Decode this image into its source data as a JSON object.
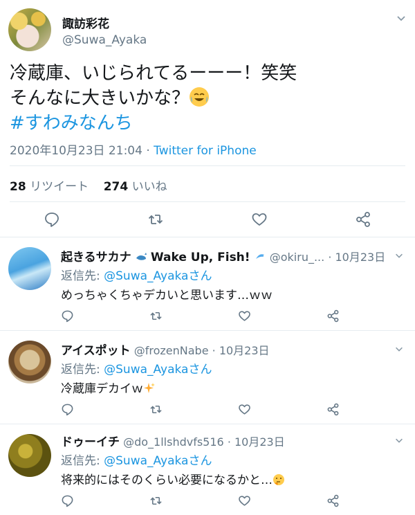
{
  "tweet": {
    "name": "諏訪彩花",
    "handle": "@Suwa_Ayaka",
    "text_line1": "冷蔵庫、いじられてるーーー！笑笑",
    "text_line2": "そんなに大きいかな？",
    "text_emoji": "face-with-tears-of-joy-icon",
    "hashtag": "#すわみなんち",
    "date": "2020年10月23日 21:04",
    "dot": "·",
    "source": "Twitter for iPhone",
    "retweet_count": "28",
    "retweet_label": "リツイート",
    "like_count": "274",
    "like_label": "いいね"
  },
  "replies": [
    {
      "name": "起きるサカナ",
      "name_extra": "Wake Up, Fish!",
      "handle": "@okiru_...",
      "date": "· 10月23日",
      "reply_prefix": "返信先: ",
      "reply_target": "@Suwa_Ayakaさん",
      "body": "めっちゃくちゃデカいと思います…ｗｗ"
    },
    {
      "name": "アイスポット",
      "handle": "@frozenNabe",
      "date": "· 10月23日",
      "reply_prefix": "返信先: ",
      "reply_target": "@Suwa_Ayakaさん",
      "body": "冷蔵庫デカイｗ"
    },
    {
      "name": "ドゥーイチ",
      "handle": "@do_1llshdvfs516",
      "date": "· 10月23日",
      "reply_prefix": "返信先: ",
      "reply_target": "@Suwa_Ayakaさん",
      "body": "将来的にはそのくらい必要になるかと…"
    }
  ],
  "colors": {
    "link": "#1b95e0",
    "secondary": "#657786",
    "divider": "#e6ecf0",
    "icon": "#657786"
  }
}
